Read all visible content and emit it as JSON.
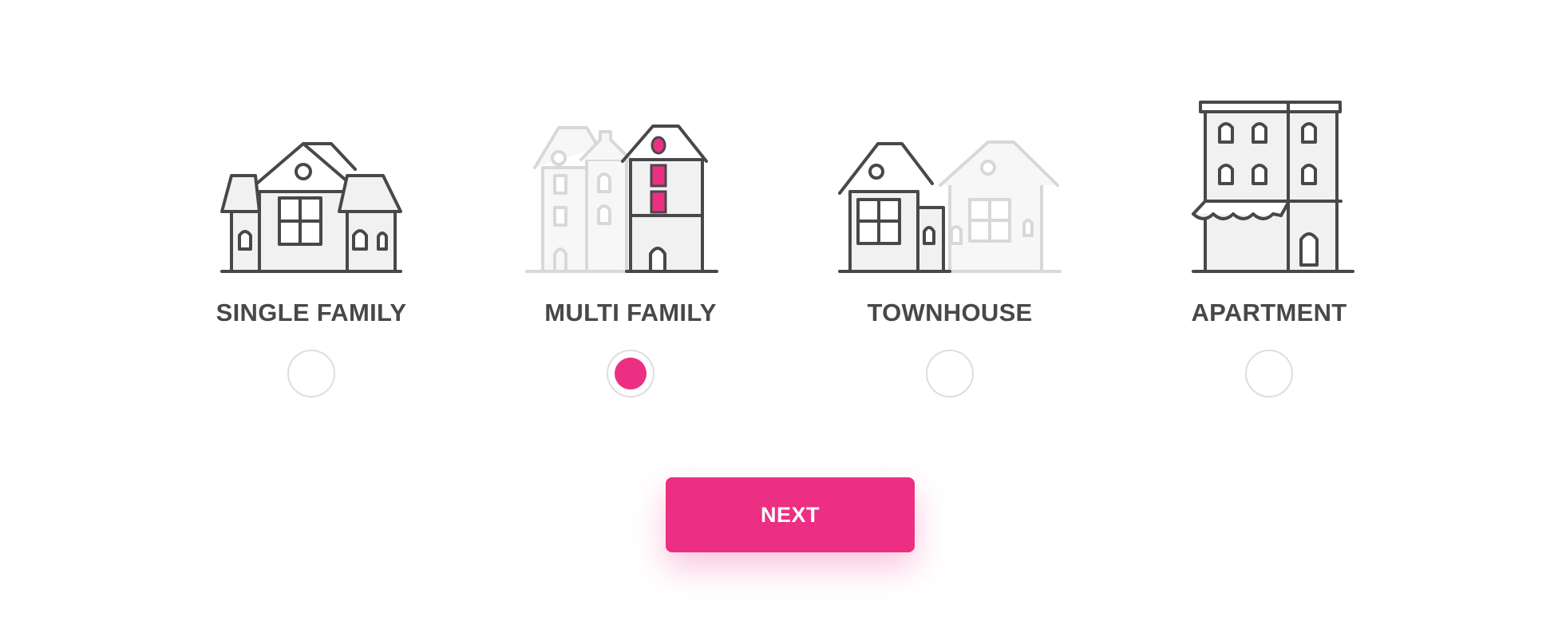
{
  "options": [
    {
      "label": "SINGLE FAMILY",
      "icon": "single-family-house-icon",
      "selected": false
    },
    {
      "label": "MULTI FAMILY",
      "icon": "multi-family-house-icon",
      "selected": true
    },
    {
      "label": "TOWNHOUSE",
      "icon": "townhouse-icon",
      "selected": false
    },
    {
      "label": "APARTMENT",
      "icon": "apartment-building-icon",
      "selected": false
    }
  ],
  "next_button": {
    "label": "NEXT"
  },
  "colors": {
    "accent": "#ec2f83",
    "icon_stroke": "#48484a",
    "icon_faded": "#d8d8d8",
    "radio_border": "#dedede"
  }
}
